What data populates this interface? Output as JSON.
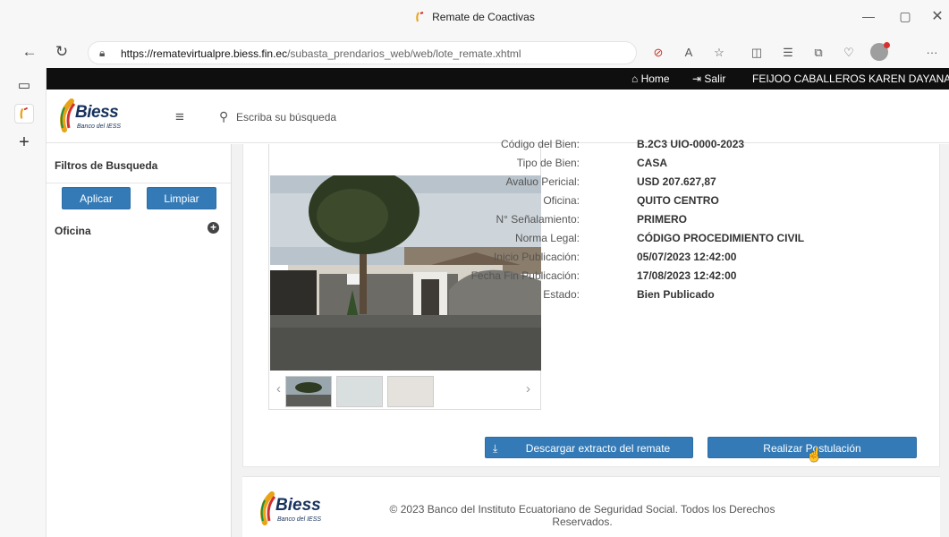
{
  "browser": {
    "window_title": "Remate de Coactivas",
    "url_host": "https://rematevirtualpre.biess.fin.ec",
    "url_path": "/subasta_prendarios_web/web/lote_remate.xhtml"
  },
  "topbar": {
    "home_label": "Home",
    "salir_label": "Salir",
    "user_name": "FEIJOO CABALLEROS KAREN DAYANA"
  },
  "header": {
    "logo_text": "Biess",
    "logo_sub": "Banco del IESS",
    "search_placeholder": "Escriba su búsqueda"
  },
  "sidebar": {
    "title": "Filtros de Busqueda",
    "apply_label": "Aplicar",
    "clear_label": "Limpiar",
    "oficina_label": "Oficina"
  },
  "details": [
    {
      "label": "Código del Bien:",
      "value": "B.2C3 UIO-0000-2023"
    },
    {
      "label": "Tipo de Bien:",
      "value": "CASA"
    },
    {
      "label": "Avaluo Pericial:",
      "value": "USD 207.627,87"
    },
    {
      "label": "Oficina:",
      "value": "QUITO CENTRO"
    },
    {
      "label": "N° Señalamiento:",
      "value": "PRIMERO"
    },
    {
      "label": "Norma Legal:",
      "value": "CÓDIGO PROCEDIMIENTO CIVIL"
    },
    {
      "label": "Inicio Publicación:",
      "value": "05/07/2023 12:42:00"
    },
    {
      "label": "Fecha Fin Publicación:",
      "value": "17/08/2023 12:42:00"
    },
    {
      "label": "Estado:",
      "value": "Bien Publicado"
    }
  ],
  "actions": {
    "download_label": "Descargar extracto del remate",
    "apply_label": "Realizar Postulación"
  },
  "footer": {
    "copyright": "© 2023 Banco del Instituto Ecuatoriano de Seguridad Social. Todos los Derechos Reservados."
  }
}
